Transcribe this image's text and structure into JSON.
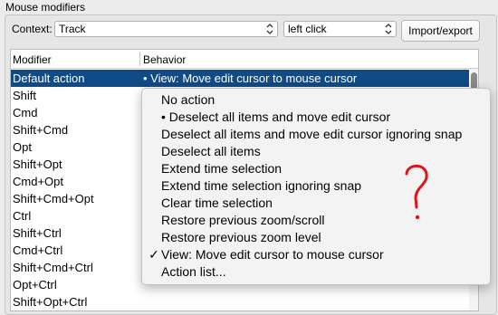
{
  "window": {
    "group_title": "Mouse modifiers"
  },
  "context": {
    "label": "Context:",
    "select1_value": "Track",
    "select2_value": "left click"
  },
  "toolbar": {
    "import_label": "Import/export"
  },
  "table": {
    "col_modifier": "Modifier",
    "col_behavior": "Behavior",
    "rows": [
      {
        "modifier": "Default action",
        "behavior": "• View: Move edit cursor to mouse cursor"
      },
      {
        "modifier": "Shift",
        "behavior": ""
      },
      {
        "modifier": "Cmd",
        "behavior": ""
      },
      {
        "modifier": "Shift+Cmd",
        "behavior": ""
      },
      {
        "modifier": "Opt",
        "behavior": ""
      },
      {
        "modifier": "Shift+Opt",
        "behavior": ""
      },
      {
        "modifier": "Cmd+Opt",
        "behavior": ""
      },
      {
        "modifier": "Shift+Cmd+Opt",
        "behavior": ""
      },
      {
        "modifier": "Ctrl",
        "behavior": ""
      },
      {
        "modifier": "Shift+Ctrl",
        "behavior": ""
      },
      {
        "modifier": "Cmd+Ctrl",
        "behavior": ""
      },
      {
        "modifier": "Shift+Cmd+Ctrl",
        "behavior": ""
      },
      {
        "modifier": "Opt+Ctrl",
        "behavior": ""
      },
      {
        "modifier": "Shift+Opt+Ctrl",
        "behavior": ""
      }
    ]
  },
  "menu": {
    "items": [
      {
        "mark": "",
        "label": "No action"
      },
      {
        "mark": "",
        "label": "• Deselect all items and move edit cursor"
      },
      {
        "mark": "",
        "label": "Deselect all items and move edit cursor ignoring snap"
      },
      {
        "mark": "",
        "label": "Deselect all items"
      },
      {
        "mark": "",
        "label": "Extend time selection"
      },
      {
        "mark": "",
        "label": "Extend time selection ignoring snap"
      },
      {
        "mark": "",
        "label": "Clear time selection"
      },
      {
        "mark": "",
        "label": "Restore previous zoom/scroll"
      },
      {
        "mark": "",
        "label": "Restore previous zoom level"
      },
      {
        "mark": "✓",
        "label": "View: Move edit cursor to mouse cursor"
      },
      {
        "mark": "",
        "label": "Action list..."
      }
    ]
  },
  "annotation": {
    "color": "#e0141a",
    "icon": "question-mark-scribble"
  },
  "colors": {
    "selection": "#0f4b87"
  }
}
